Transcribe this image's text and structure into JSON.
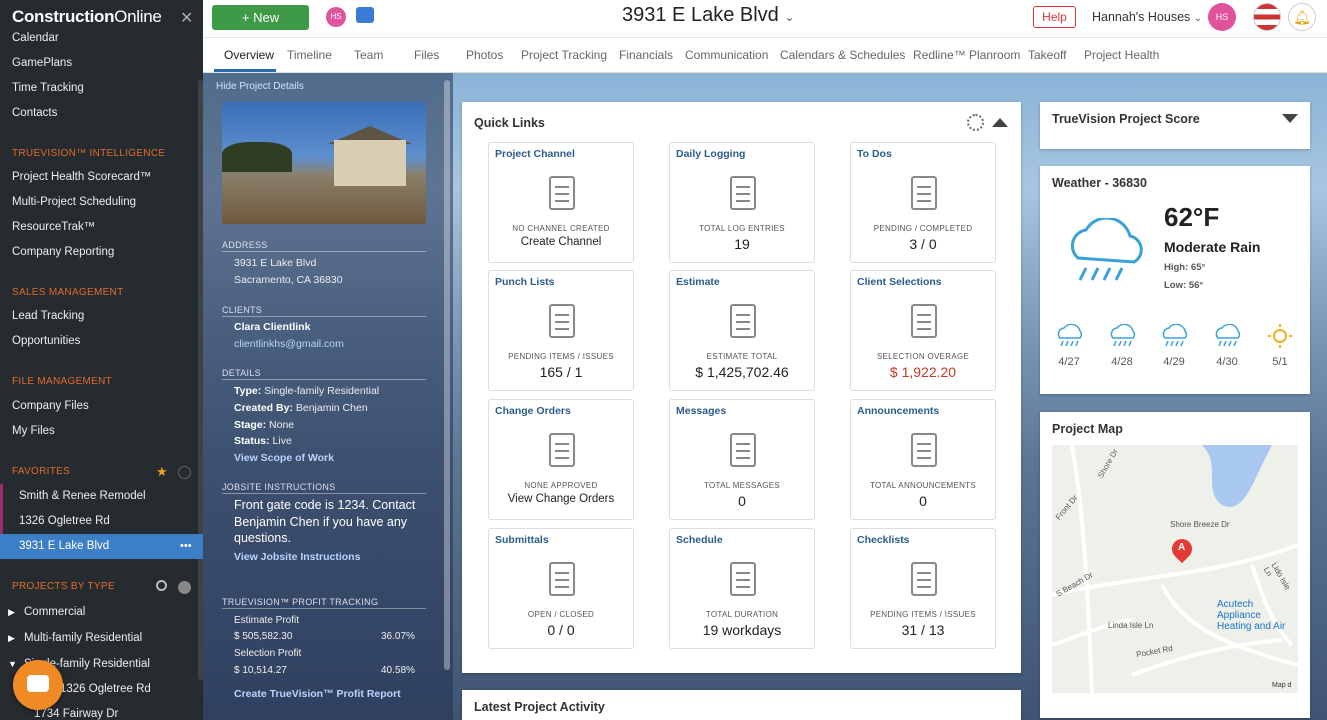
{
  "app": {
    "logo_bold": "Construction",
    "logo_light": "Online",
    "trademark": "™"
  },
  "sidebar": {
    "top_items": [
      "Calendar",
      "GamePlans",
      "Time Tracking",
      "Contacts"
    ],
    "intel_heading": "TRUEVISION™ INTELLIGENCE",
    "intel_items": [
      "Project Health Scorecard™",
      "Multi-Project Scheduling",
      "ResourceTrak™",
      "Company Reporting"
    ],
    "sales_heading": "SALES MANAGEMENT",
    "sales_items": [
      "Lead Tracking",
      "Opportunities"
    ],
    "files_heading": "FILE MANAGEMENT",
    "files_items": [
      "Company Files",
      "My Files"
    ],
    "favorites_heading": "FAVORITES",
    "favorites": [
      "Smith & Renee Remodel",
      "1326 Ogletree Rd",
      "3931 E Lake Blvd"
    ],
    "projects_heading": "PROJECTS BY TYPE",
    "types": [
      "Commercial",
      "Multi-family Residential",
      "Single-family Residential"
    ],
    "sub_items": [
      "1326 Ogletree Rd",
      "1734 Fairway Dr"
    ]
  },
  "topbar": {
    "new_label": "New",
    "avatar": "HS",
    "title": "3931 E Lake Blvd",
    "help": "Help",
    "company": "Hannah's Houses"
  },
  "tabs": [
    "Overview",
    "Timeline",
    "Team",
    "Files",
    "Photos",
    "Project Tracking",
    "Financials",
    "Communication",
    "Calendars & Schedules",
    "Redline™ Planroom",
    "Takeoff",
    "Project Health"
  ],
  "details": {
    "hide_link": "Hide Project Details",
    "address_label": "ADDRESS",
    "address_line1": "3931 E Lake Blvd",
    "address_line2": "Sacramento, CA 36830",
    "clients_label": "CLIENTS",
    "client_name": "Clara Clientlink",
    "client_email": "clientlinkhs@gmail.com",
    "details_label": "DETAILS",
    "type_k": "Type:",
    "type_v": "Single-family Residential",
    "created_k": "Created By:",
    "created_v": "Benjamin Chen",
    "stage_k": "Stage:",
    "stage_v": "None",
    "status_k": "Status:",
    "status_v": "Live",
    "scope_link": "View Scope of Work",
    "jobsite_label": "JOBSITE INSTRUCTIONS",
    "jobsite_text": "Front gate code is 1234. Contact Benjamin Chen if you have any questions.",
    "jobsite_link": "View Jobsite Instructions",
    "profit_label": "TRUEVISION™ PROFIT TRACKING",
    "est_profit_label": "Estimate Profit",
    "est_profit_value": "$ 505,582.30",
    "est_profit_pct": "36.07%",
    "sel_profit_label": "Selection Profit",
    "sel_profit_value": "$ 10,514.27",
    "sel_profit_pct": "40.58%",
    "profit_report_link": "Create TrueVision™ Profit Report"
  },
  "quick_links": {
    "title": "Quick Links",
    "tiles": [
      {
        "title": "Project Channel",
        "label": "NO CHANNEL CREATED",
        "value": "Create Channel",
        "icon": "chat-icon"
      },
      {
        "title": "Daily Logging",
        "label": "TOTAL LOG ENTRIES",
        "value": "19",
        "icon": "log-icon"
      },
      {
        "title": "To Dos",
        "label": "PENDING / COMPLETED",
        "value": "3 / 0",
        "icon": "checkbox-icon"
      },
      {
        "title": "Punch Lists",
        "label": "PENDING ITEMS / ISSUES",
        "value": "165 / 1",
        "icon": "clipboard-icon"
      },
      {
        "title": "Estimate",
        "label": "ESTIMATE TOTAL",
        "value": "$ 1,425,702.46",
        "icon": "pie-icon"
      },
      {
        "title": "Client Selections",
        "label": "SELECTION OVERAGE",
        "value": "$ 1,922.20",
        "icon": "swatch-icon"
      },
      {
        "title": "Change Orders",
        "label": "NONE APPROVED",
        "value": "View Change Orders",
        "icon": "branch-arrow-icon"
      },
      {
        "title": "Messages",
        "label": "TOTAL MESSAGES",
        "value": "0",
        "icon": "envelope-icon"
      },
      {
        "title": "Announcements",
        "label": "TOTAL ANNOUNCEMENTS",
        "value": "0",
        "icon": "megaphone-icon"
      },
      {
        "title": "Submittals",
        "label": "OPEN / CLOSED",
        "value": "0 / 0",
        "icon": "tray-icon"
      },
      {
        "title": "Schedule",
        "label": "TOTAL DURATION",
        "value": "19 workdays",
        "icon": "gantt-icon"
      },
      {
        "title": "Checklists",
        "label": "PENDING ITEMS / ISSUES",
        "value": "31 / 13",
        "icon": "checklist-icon"
      }
    ]
  },
  "latest_activity": {
    "title": "Latest Project Activity"
  },
  "truevision": {
    "title": "TrueVision Project Score"
  },
  "weather": {
    "title": "Weather - 36830",
    "temp": "62°F",
    "condition": "Moderate Rain",
    "high": "High: 65°",
    "low": "Low: 56°",
    "forecast": [
      {
        "day": "4/27",
        "icon": "rain-icon"
      },
      {
        "day": "4/28",
        "icon": "rain-icon"
      },
      {
        "day": "4/29",
        "icon": "rain-icon"
      },
      {
        "day": "4/30",
        "icon": "rain-icon"
      },
      {
        "day": "5/1",
        "icon": "sun-icon"
      }
    ]
  },
  "map": {
    "title": "Project Map",
    "streets": [
      "Shore Breeze Dr",
      "Front Dr",
      "S Beach Dr",
      "Linda Isle Ln",
      "Pocket Rd",
      "Lido Isle Ln",
      "Shore Dr"
    ],
    "poi": "Acutech Appliance Heating and Air",
    "marker": "A",
    "attribution": "Map d"
  },
  "colors": {
    "accent": "#2b6cb0",
    "brand_green": "#3f9a48",
    "section_heading": "#e06a2b",
    "avatar": "#e0529c",
    "overage_red": "#c0392b"
  }
}
